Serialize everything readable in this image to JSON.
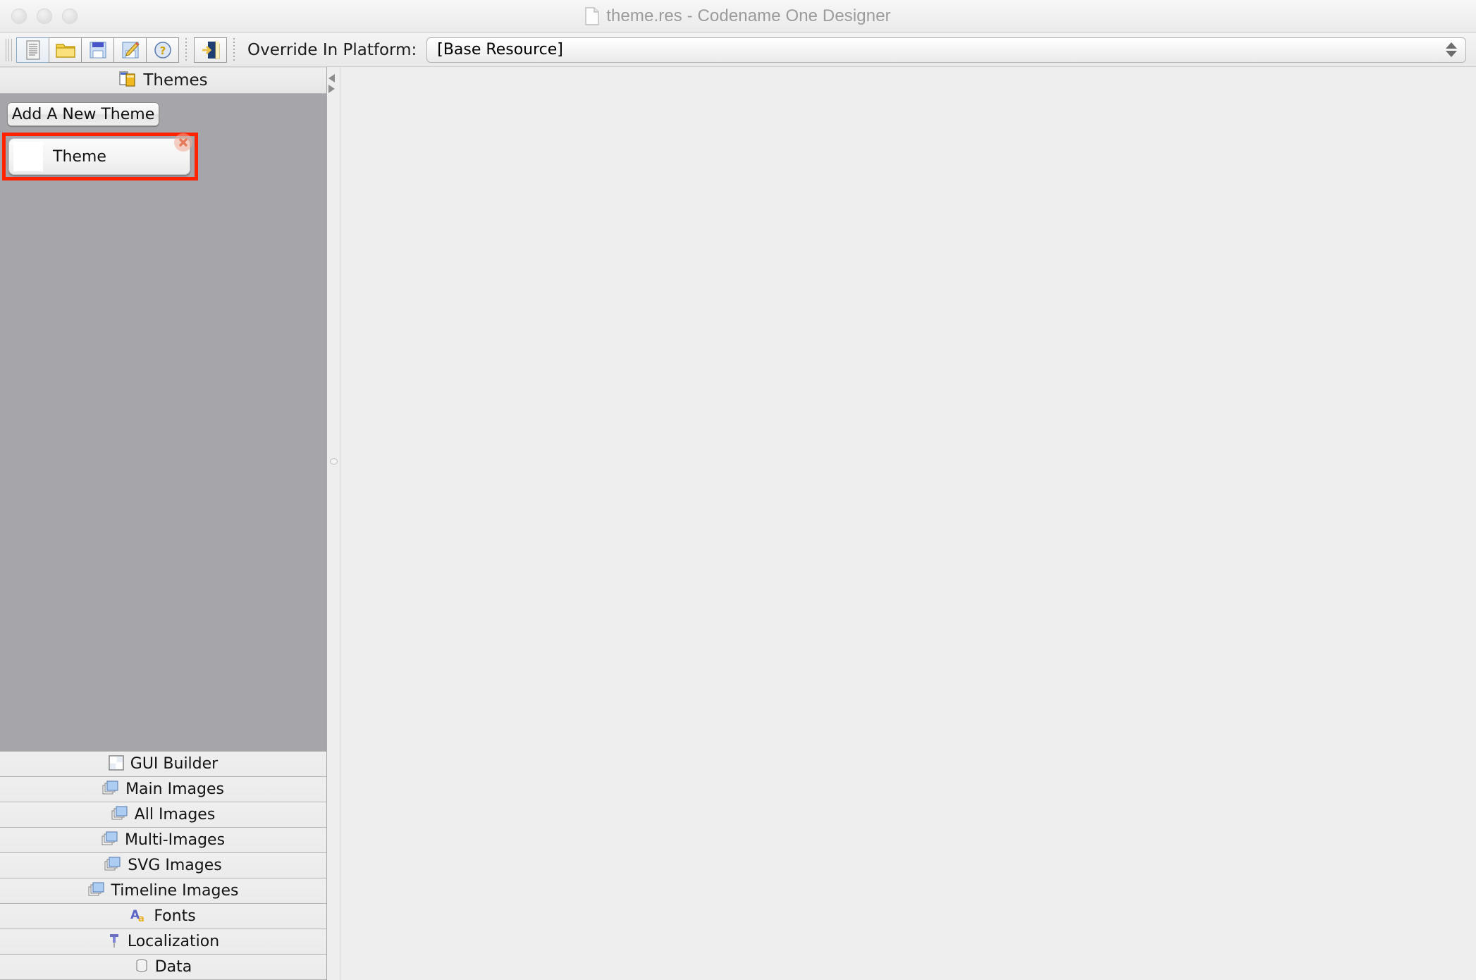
{
  "window": {
    "title": "theme.res - Codename One Designer",
    "doc_icon": "document-icon",
    "traffic_lights": [
      "close-button",
      "minimize-button",
      "maximize-button"
    ]
  },
  "toolbar": {
    "buttons": [
      {
        "name": "new-resource-button",
        "icon": "new-document-icon",
        "selected": true
      },
      {
        "name": "open-resource-button",
        "icon": "open-folder-icon",
        "selected": false
      },
      {
        "name": "save-button",
        "icon": "save-floppy-icon",
        "selected": false
      },
      {
        "name": "save-as-button",
        "icon": "save-as-pencil-icon",
        "selected": false
      },
      {
        "name": "help-button",
        "icon": "help-question-icon",
        "selected": false
      }
    ],
    "quit_button": {
      "name": "quit-button",
      "icon": "exit-door-icon"
    },
    "override_label": "Override In Platform:",
    "override_value": "[Base Resource]",
    "override_options": [
      "[Base Resource]"
    ]
  },
  "left_panel": {
    "header": {
      "title": "Themes",
      "icon": "themes-icon"
    },
    "add_theme_label": "Add A New Theme",
    "themes": [
      {
        "name": "Theme",
        "delete_icon": "close-x-icon",
        "highlighted": true
      }
    ],
    "highlight_color": "#ff2200",
    "background_color": "#a6a6aa"
  },
  "nav": {
    "items": [
      {
        "label": "GUI Builder",
        "icon": "grid-layout-icon"
      },
      {
        "label": "Main Images",
        "icon": "images-stack-icon"
      },
      {
        "label": "All Images",
        "icon": "images-stack-icon"
      },
      {
        "label": "Multi-Images",
        "icon": "images-stack-icon"
      },
      {
        "label": "SVG Images",
        "icon": "images-stack-icon"
      },
      {
        "label": "Timeline Images",
        "icon": "images-stack-icon"
      },
      {
        "label": "Fonts",
        "icon": "fonts-aa-icon"
      },
      {
        "label": "Localization",
        "icon": "pushpin-icon"
      },
      {
        "label": "Data",
        "icon": "database-cylinder-icon"
      }
    ]
  },
  "splitter": {
    "collapse_left_icon": "triangle-left-icon",
    "collapse_right_icon": "triangle-right-icon",
    "grip_icon": "splitter-grip-icon"
  },
  "main": {
    "content": "",
    "background_color": "#eeeeee"
  }
}
